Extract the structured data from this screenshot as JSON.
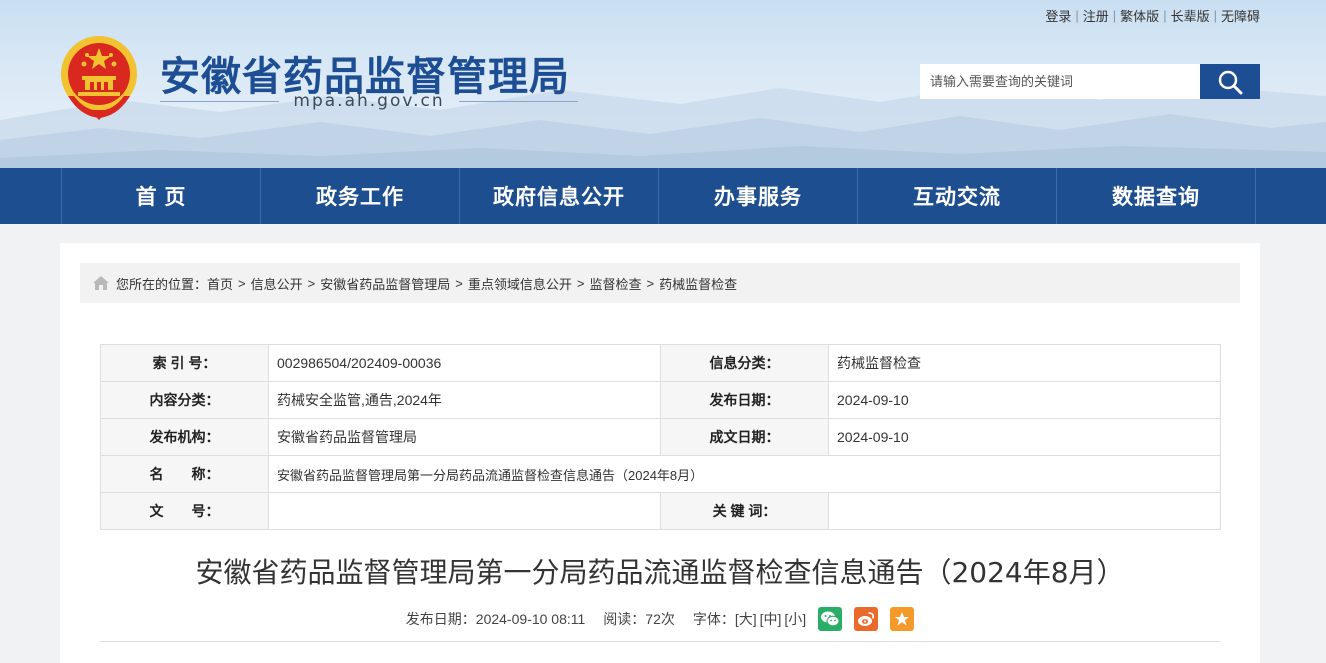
{
  "top_links": [
    "登录",
    "注册",
    "繁体版",
    "长辈版",
    "无障碍"
  ],
  "site": {
    "title": "安徽省药品监督管理局",
    "domain": "mpa.ah.gov.cn"
  },
  "search": {
    "placeholder": "请输入需要查询的关键词",
    "icon": "search-icon"
  },
  "nav": [
    "首 页",
    "政务工作",
    "政府信息公开",
    "办事服务",
    "互动交流",
    "数据查询"
  ],
  "breadcrumb": {
    "prefix": "您所在的位置：",
    "items": [
      "首页",
      "信息公开",
      "安徽省药品监督管理局",
      "重点领域信息公开",
      "监督检查",
      "药械监督检查"
    ],
    "separator": ">"
  },
  "meta_table": {
    "index_label": "索 引 号：",
    "index_value": "002986504/202409-00036",
    "category_label": "信息分类：",
    "category_value": "药械监督检查",
    "content_label": "内容分类：",
    "content_value": "药械安全监管,通告,2024年",
    "publish_date_label": "发布日期：",
    "publish_date_value": "2024-09-10",
    "org_label": "发布机构：",
    "org_value": "安徽省药品监督管理局",
    "written_date_label": "成文日期：",
    "written_date_value": "2024-09-10",
    "name_label": "名　　称：",
    "name_value": "安徽省药品监督管理局第一分局药品流通监督检查信息通告（2024年8月）",
    "doc_no_label": "文　　号：",
    "doc_no_value": "",
    "keywords_label": "关 键 词：",
    "keywords_value": ""
  },
  "article": {
    "title": "安徽省药品监督管理局第一分局药品流通监督检查信息通告（2024年8月）",
    "publish": "发布日期：2024-09-10 08:11",
    "views": "阅读：72次",
    "font_label": "字体：",
    "font_large": "[大]",
    "font_medium": "[中]",
    "font_small": "[小]"
  },
  "share_icons": [
    "wechat-icon",
    "weibo-icon",
    "favorite-star-icon"
  ],
  "colors": {
    "brand_blue": "#1d4e93",
    "nav_blue": "#1d4e8f",
    "wechat_green": "#2aae67",
    "weibo_orange": "#ea6a2c",
    "star_orange": "#f39a2a",
    "emblem_red": "#d8281f",
    "emblem_gold": "#f2c230"
  }
}
